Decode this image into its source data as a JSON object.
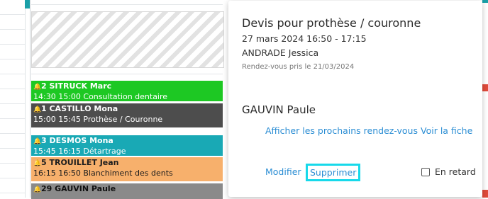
{
  "calendar": {
    "appointments": [
      {
        "line1": "2 SITRUCK Marc",
        "line2": "14:30 15:00 Consultation dentaire",
        "color": "#1dc823"
      },
      {
        "line1": "1 CASTILLO Mona",
        "line2": "15:00 15:45 Prothèse / Couronne",
        "color": "#4d4d4d"
      },
      {
        "line1": "3 DESMOS Mona",
        "line2": "15:45 16:15 Détartrage",
        "color": "#19a9b5"
      },
      {
        "line1": "5 TROUILLET Jean",
        "line2": "16:15 16:50 Blanchiment des dents",
        "color": "#f7b06c"
      },
      {
        "line1": "29 GAUVIN Paule",
        "line2": "",
        "color": "#8a8a8a"
      }
    ]
  },
  "popover": {
    "title": "Devis pour prothèse / couronne",
    "datetime": "27 mars 2024 16:50 - 17:15",
    "patient": "ANDRADE Jessica",
    "taken_on": "Rendez-vous pris le 21/03/2024",
    "doctor": "GAUVIN Paule",
    "link_next": "Afficher les prochains rendez-vous",
    "link_file": "Voir la fiche",
    "edit": "Modifier",
    "delete": "Supprimer",
    "late_label": "En retard",
    "late_checked": false
  }
}
